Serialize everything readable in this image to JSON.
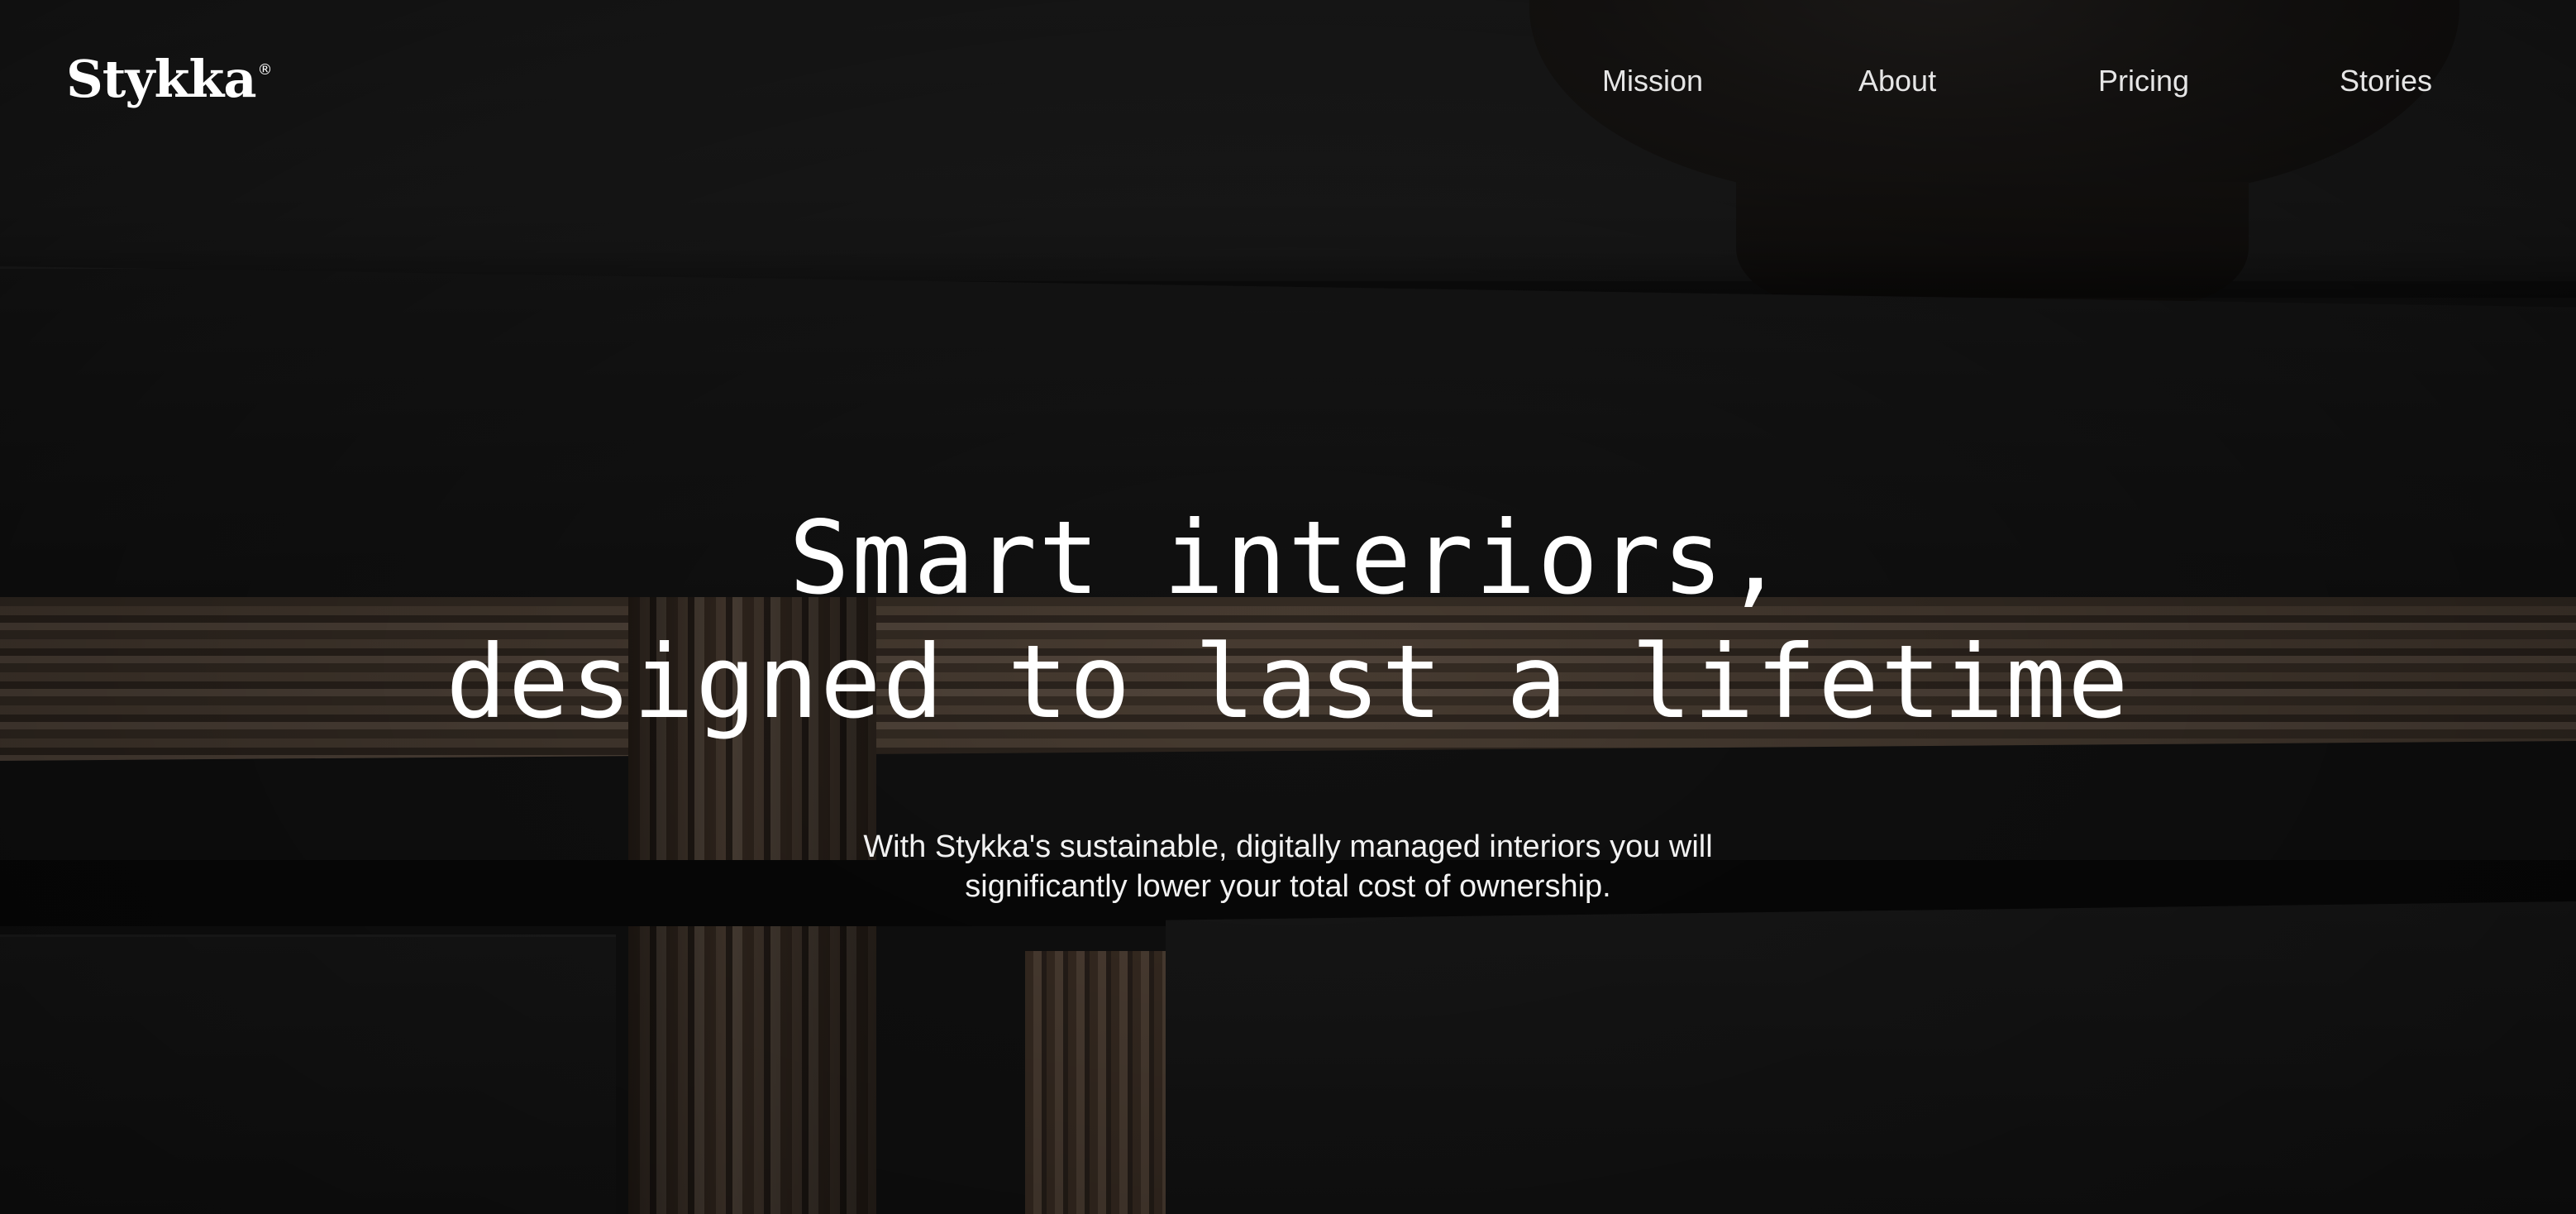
{
  "brand": {
    "name": "Stykka",
    "registered_mark": "®"
  },
  "nav": {
    "items": [
      {
        "label": "Mission"
      },
      {
        "label": "About"
      },
      {
        "label": "Pricing"
      },
      {
        "label": "Stories"
      }
    ]
  },
  "hero": {
    "headline_line1": "Smart interiors,",
    "headline_line2": "designed to last a lifetime",
    "subtext": "With Stykka's sustainable, digitally managed interiors you will significantly lower your total cost of ownership.",
    "background_image": "dark-sideboard-plywood-photo"
  },
  "colors": {
    "text": "#ffffff",
    "nav_text": "#e6e6e6",
    "background": "#1a1a1a"
  }
}
